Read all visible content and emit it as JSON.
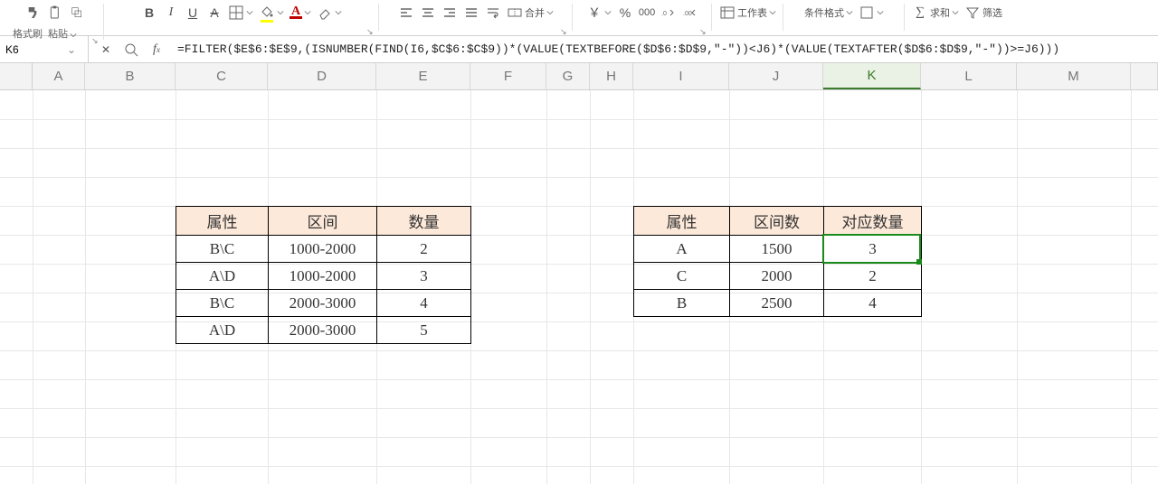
{
  "toolbar": {
    "format_painter": "格式刷",
    "paste": "粘贴",
    "merge": "合并",
    "worksheet": "工作表",
    "cond_format": "条件格式",
    "sum": "求和",
    "filter": "筛选",
    "currency_glyph": "￥",
    "percent_glyph": "%",
    "thousands_glyph": "000"
  },
  "cell_ref": "K6",
  "formula": "=FILTER($E$6:$E$9,(ISNUMBER(FIND(I6,$C$6:$C$9))*(VALUE(TEXTBEFORE($D$6:$D$9,\"-\"))<J6)*(VALUE(TEXTAFTER($D$6:$D$9,\"-\"))>=J6)))",
  "columns": [
    "A",
    "B",
    "C",
    "D",
    "E",
    "F",
    "G",
    "H",
    "I",
    "J",
    "K",
    "L",
    "M"
  ],
  "table1": {
    "headers": [
      "属性",
      "区间",
      "数量"
    ],
    "rows": [
      [
        "B\\C",
        "1000-2000",
        "2"
      ],
      [
        "A\\D",
        "1000-2000",
        "3"
      ],
      [
        "B\\C",
        "2000-3000",
        "4"
      ],
      [
        "A\\D",
        "2000-3000",
        "5"
      ]
    ]
  },
  "table2": {
    "headers": [
      "属性",
      "区间数",
      "对应数量"
    ],
    "rows": [
      [
        "A",
        "1500",
        "3"
      ],
      [
        "C",
        "2000",
        "2"
      ],
      [
        "B",
        "2500",
        "4"
      ]
    ]
  },
  "active_column": "K"
}
